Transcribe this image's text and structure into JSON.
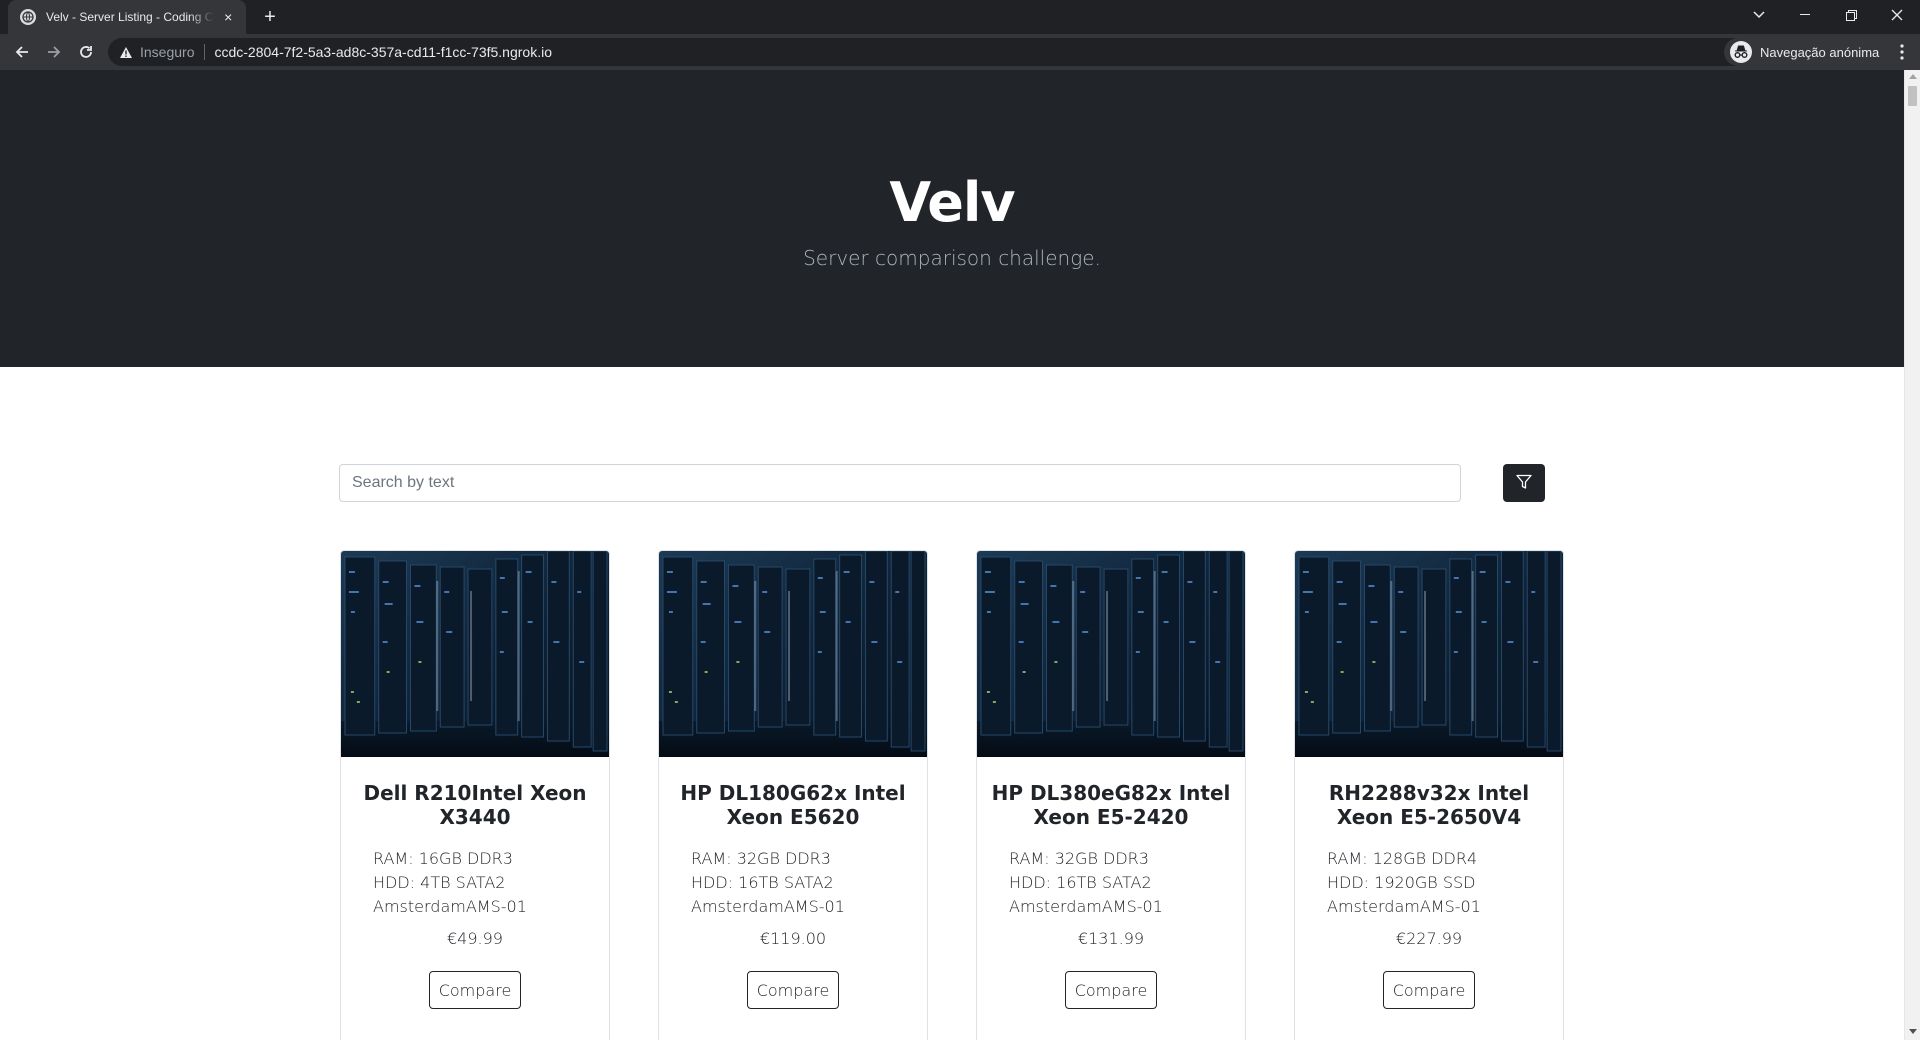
{
  "browser": {
    "tab_title": "Velv - Server Listing - Coding Challenge",
    "tab_close": "×",
    "new_tab": "+",
    "insecure_label": "Inseguro",
    "url": "ccdc-2804-7f2-5a3-ad8c-357a-cd11-f1cc-73f5.ngrok.io",
    "incognito_label": "Navegação anónima",
    "icons": [
      "back-icon",
      "forward-icon",
      "reload-icon",
      "warning-icon",
      "translate-icon",
      "star-icon",
      "incognito-icon",
      "menu-icon",
      "tab-search-icon",
      "minimize-icon",
      "restore-icon",
      "close-window-icon"
    ]
  },
  "hero": {
    "title": "Velv",
    "subtitle": "Server comparison challenge."
  },
  "search": {
    "placeholder": "Search by text",
    "value": "",
    "filter_icon": "filter-icon"
  },
  "servers": [
    {
      "title": "Dell R210Intel Xeon X3440",
      "ram": "RAM: 16GB DDR3",
      "hdd": "HDD: 4TB SATA2",
      "location": "AmsterdamAMS-01",
      "price": "€49.99",
      "compare_label": "Compare"
    },
    {
      "title": "HP DL180G62x Intel Xeon E5620",
      "ram": "RAM: 32GB DDR3",
      "hdd": "HDD: 16TB SATA2",
      "location": "AmsterdamAMS-01",
      "price": "€119.00",
      "compare_label": "Compare"
    },
    {
      "title": "HP DL380eG82x Intel Xeon E5-2420",
      "ram": "RAM: 32GB DDR3",
      "hdd": "HDD: 16TB SATA2",
      "location": "AmsterdamAMS-01",
      "price": "€131.99",
      "compare_label": "Compare"
    },
    {
      "title": "RH2288v32x Intel Xeon E5-2650V4",
      "ram": "RAM: 128GB DDR4",
      "hdd": "HDD: 1920GB SSD",
      "location": "AmsterdamAMS-01",
      "price": "€227.99",
      "compare_label": "Compare"
    }
  ],
  "colors": {
    "hero_bg": "#212529",
    "hero_subtitle": "#adb5bd",
    "browser_frame": "#202124",
    "browser_toolbar": "#35363a"
  }
}
